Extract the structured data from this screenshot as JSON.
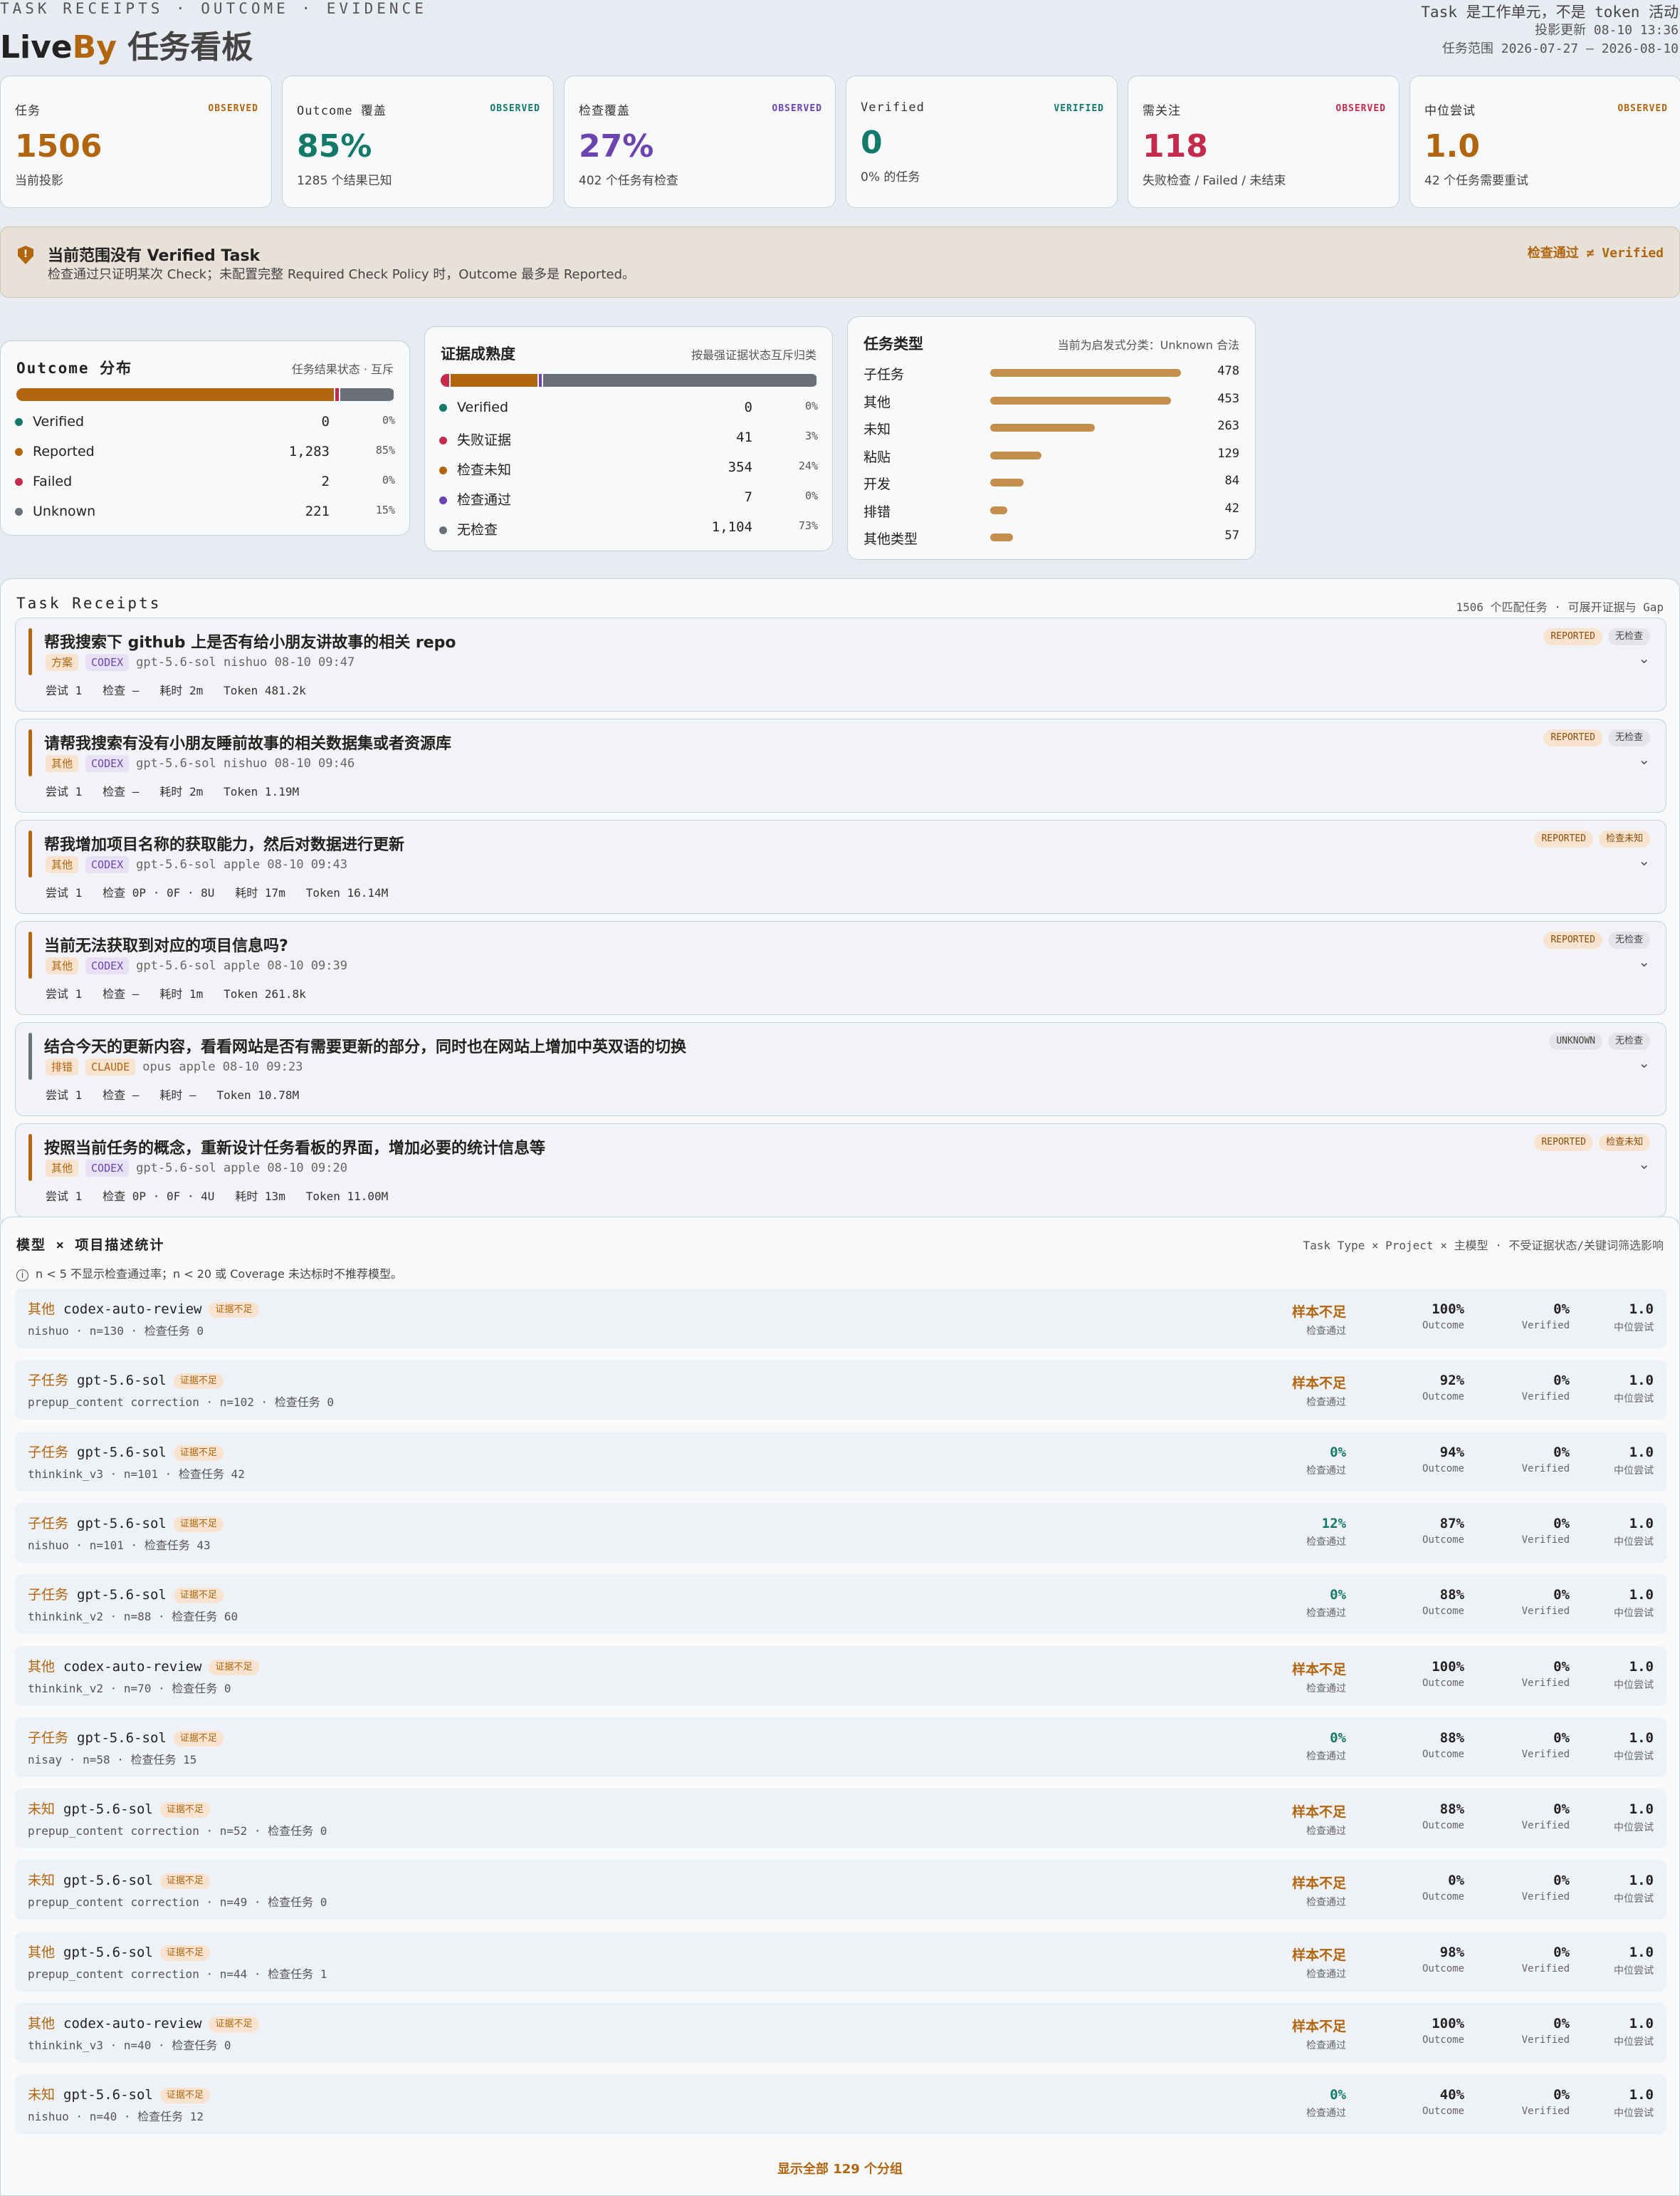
{
  "header": {
    "eyebrow": "TASK RECEIPTS · OUTCOME · EVIDENCE",
    "brand_live": "Live",
    "brand_by": "By",
    "title": "任务看板",
    "note": "Task 是工作单元，不是 token 活动",
    "updated": "投影更新 08-10 13:36",
    "range": "任务范围 2026-07-27 — 2026-08-10"
  },
  "kpis": [
    {
      "label": "任务",
      "tag": "OBSERVED",
      "value": "1506",
      "sub": "当前投影",
      "color": "#b0650e",
      "tagcolor": "#b0650e"
    },
    {
      "label": "Outcome 覆盖",
      "tag": "OBSERVED",
      "value": "85%",
      "sub": "1285 个结果已知",
      "color": "#137a6b",
      "tagcolor": "#137a6b"
    },
    {
      "label": "检查覆盖",
      "tag": "OBSERVED",
      "value": "27%",
      "sub": "402 个任务有检查",
      "color": "#6a45b0",
      "tagcolor": "#6a45b0"
    },
    {
      "label": "Verified",
      "tag": "VERIFIED",
      "value": "0",
      "sub": "0% 的任务",
      "color": "#137a6b",
      "tagcolor": "#137a6b"
    },
    {
      "label": "需关注",
      "tag": "OBSERVED",
      "value": "118",
      "sub": "失败检查 / Failed / 未结束",
      "color": "#c42a4c",
      "tagcolor": "#c42a4c"
    },
    {
      "label": "中位尝试",
      "tag": "OBSERVED",
      "value": "1.0",
      "sub": "42 个任务需要重试",
      "color": "#b0650e",
      "tagcolor": "#b0650e"
    }
  ],
  "alert": {
    "icon": "shield-alert-icon",
    "title": "当前范围没有 Verified Task",
    "text": "检查通过只证明某次 Check；未配置完整 Required Check Policy 时，Outcome 最多是 Reported。",
    "tag": "检查通过 ≠ Verified"
  },
  "outcome": {
    "title": "Outcome 分布",
    "subtitle": "任务结果状态 · 互斥",
    "rows": [
      {
        "label": "Verified",
        "count": "0",
        "pct": "0%",
        "color": "#137a6b",
        "share": 0
      },
      {
        "label": "Reported",
        "count": "1,283",
        "pct": "85%",
        "color": "#b0650e",
        "share": 85.2
      },
      {
        "label": "Failed",
        "count": "2",
        "pct": "0%",
        "color": "#c42a4c",
        "share": 0.13
      },
      {
        "label": "Unknown",
        "count": "221",
        "pct": "15%",
        "color": "#6b6f78",
        "share": 14.7
      }
    ]
  },
  "evidence": {
    "title": "证据成熟度",
    "subtitle": "按最强证据状态互斥归类",
    "rows": [
      {
        "label": "Verified",
        "count": "0",
        "pct": "0%",
        "color": "#137a6b",
        "share": 0
      },
      {
        "label": "失败证据",
        "count": "41",
        "pct": "3%",
        "color": "#c42a4c",
        "share": 2.7
      },
      {
        "label": "检查未知",
        "count": "354",
        "pct": "24%",
        "color": "#b0650e",
        "share": 23.5
      },
      {
        "label": "检查通过",
        "count": "7",
        "pct": "0%",
        "color": "#6a45b0",
        "share": 0.5
      },
      {
        "label": "无检查",
        "count": "1,104",
        "pct": "73%",
        "color": "#6b6f78",
        "share": 73.3
      }
    ]
  },
  "types": {
    "title": "任务类型",
    "subtitle": "当前为启发式分类：Unknown 合法",
    "rows": [
      {
        "label": "子任务",
        "count": "478",
        "v": 478
      },
      {
        "label": "其他",
        "count": "453",
        "v": 453
      },
      {
        "label": "未知",
        "count": "263",
        "v": 263
      },
      {
        "label": "粘贴",
        "count": "129",
        "v": 129
      },
      {
        "label": "开发",
        "count": "84",
        "v": 84
      },
      {
        "label": "排错",
        "count": "42",
        "v": 42
      },
      {
        "label": "其他类型",
        "count": "57",
        "v": 57
      }
    ]
  },
  "receipts": {
    "title": "Task Receipts",
    "subtitle": "1506 个匹配任务 · 可展开证据与 Gap",
    "items": [
      {
        "title": "帮我搜索下 github 上是否有给小朋友讲故事的相关 repo",
        "type": "方案",
        "agent": "CODEX",
        "meta": "gpt-5.6-sol nishuo 08-10 09:47",
        "stat": "尝试 1   检查 —   耗时 2m   Token 481.2k",
        "outcome": "REPORTED",
        "check": "无检查",
        "accent": "#b0650e"
      },
      {
        "title": "请帮我搜索有没有小朋友睡前故事的相关数据集或者资源库",
        "type": "其他",
        "agent": "CODEX",
        "meta": "gpt-5.6-sol nishuo 08-10 09:46",
        "stat": "尝试 1   检查 —   耗时 2m   Token 1.19M",
        "outcome": "REPORTED",
        "check": "无检查",
        "accent": "#b0650e"
      },
      {
        "title": "帮我增加项目名称的获取能力，然后对数据进行更新",
        "type": "其他",
        "agent": "CODEX",
        "meta": "gpt-5.6-sol apple 08-10 09:43",
        "stat": "尝试 1   检查 0P · 0F · 8U   耗时 17m   Token 16.14M",
        "outcome": "REPORTED",
        "check": "检查未知",
        "accent": "#b0650e"
      },
      {
        "title": "当前无法获取到对应的项目信息吗?",
        "type": "其他",
        "agent": "CODEX",
        "meta": "gpt-5.6-sol apple 08-10 09:39",
        "stat": "尝试 1   检查 —   耗时 1m   Token 261.8k",
        "outcome": "REPORTED",
        "check": "无检查",
        "accent": "#b0650e"
      },
      {
        "title": "结合今天的更新内容，看看网站是否有需要更新的部分，同时也在网站上增加中英双语的切换",
        "type": "排错",
        "agent": "CLAUDE",
        "meta": "opus apple 08-10 09:23",
        "stat": "尝试 1   检查 —   耗时 —   Token 10.78M",
        "outcome": "UNKNOWN",
        "check": "无检查",
        "accent": "#6b6f78"
      },
      {
        "title": "按照当前任务的概念，重新设计任务看板的界面，增加必要的统计信息等",
        "type": "其他",
        "agent": "CODEX",
        "meta": "gpt-5.6-sol apple 08-10 09:20",
        "stat": "尝试 1   检查 0P · 0F · 4U   耗时 13m   Token 11.00M",
        "outcome": "REPORTED",
        "check": "检查未知",
        "accent": "#b0650e"
      }
    ]
  },
  "models": {
    "title": "模型 × 项目描述统计",
    "subtitle": "Task Type × Project × 主模型 · 不受证据状态/关键词筛选影响",
    "note": "n < 5 不显示检查通过率；n < 20 或 Coverage 未达标时不推荐模型。",
    "info_icon": "info-icon",
    "k_check": "检查通过",
    "k_outcome": "Outcome",
    "k_verified": "Verified",
    "k_attempt": "中位尝试",
    "footer": "显示全部 129 个分组",
    "rows": [
      {
        "type": "其他",
        "model": "codex-auto-review",
        "badge": "证据不足",
        "sub": "nishuo · n=130 · 检查任务 0",
        "check": "样本不足",
        "outcome": "100%",
        "verified": "0%",
        "attempt": "1.0",
        "cc": "#b0650e"
      },
      {
        "type": "子任务",
        "model": "gpt-5.6-sol",
        "badge": "证据不足",
        "sub": "prepup_content correction · n=102 · 检查任务 0",
        "check": "样本不足",
        "outcome": "92%",
        "verified": "0%",
        "attempt": "1.0",
        "cc": "#b0650e"
      },
      {
        "type": "子任务",
        "model": "gpt-5.6-sol",
        "badge": "证据不足",
        "sub": "thinkink_v3 · n=101 · 检查任务 42",
        "check": "0%",
        "outcome": "94%",
        "verified": "0%",
        "attempt": "1.0",
        "cc": "#137a6b"
      },
      {
        "type": "子任务",
        "model": "gpt-5.6-sol",
        "badge": "证据不足",
        "sub": "nishuo · n=101 · 检查任务 43",
        "check": "12%",
        "outcome": "87%",
        "verified": "0%",
        "attempt": "1.0",
        "cc": "#137a6b"
      },
      {
        "type": "子任务",
        "model": "gpt-5.6-sol",
        "badge": "证据不足",
        "sub": "thinkink_v2 · n=88 · 检查任务 60",
        "check": "0%",
        "outcome": "88%",
        "verified": "0%",
        "attempt": "1.0",
        "cc": "#137a6b"
      },
      {
        "type": "其他",
        "model": "codex-auto-review",
        "badge": "证据不足",
        "sub": "thinkink_v2 · n=70 · 检查任务 0",
        "check": "样本不足",
        "outcome": "100%",
        "verified": "0%",
        "attempt": "1.0",
        "cc": "#b0650e"
      },
      {
        "type": "子任务",
        "model": "gpt-5.6-sol",
        "badge": "证据不足",
        "sub": "nisay · n=58 · 检查任务 15",
        "check": "0%",
        "outcome": "88%",
        "verified": "0%",
        "attempt": "1.0",
        "cc": "#137a6b"
      },
      {
        "type": "未知",
        "model": "gpt-5.6-sol",
        "badge": "证据不足",
        "sub": "prepup_content correction · n=52 · 检查任务 0",
        "check": "样本不足",
        "outcome": "88%",
        "verified": "0%",
        "attempt": "1.0",
        "cc": "#b0650e"
      },
      {
        "type": "未知",
        "model": "gpt-5.6-sol",
        "badge": "证据不足",
        "sub": "prepup_content correction · n=49 · 检查任务 0",
        "check": "样本不足",
        "outcome": "0%",
        "verified": "0%",
        "attempt": "1.0",
        "cc": "#b0650e"
      },
      {
        "type": "其他",
        "model": "gpt-5.6-sol",
        "badge": "证据不足",
        "sub": "prepup_content correction · n=44 · 检查任务 1",
        "check": "样本不足",
        "outcome": "98%",
        "verified": "0%",
        "attempt": "1.0",
        "cc": "#b0650e"
      },
      {
        "type": "其他",
        "model": "codex-auto-review",
        "badge": "证据不足",
        "sub": "thinkink_v3 · n=40 · 检查任务 0",
        "check": "样本不足",
        "outcome": "100%",
        "verified": "0%",
        "attempt": "1.0",
        "cc": "#b0650e"
      },
      {
        "type": "未知",
        "model": "gpt-5.6-sol",
        "badge": "证据不足",
        "sub": "nishuo · n=40 · 检查任务 12",
        "check": "0%",
        "outcome": "40%",
        "verified": "0%",
        "attempt": "1.0",
        "cc": "#137a6b"
      }
    ]
  }
}
